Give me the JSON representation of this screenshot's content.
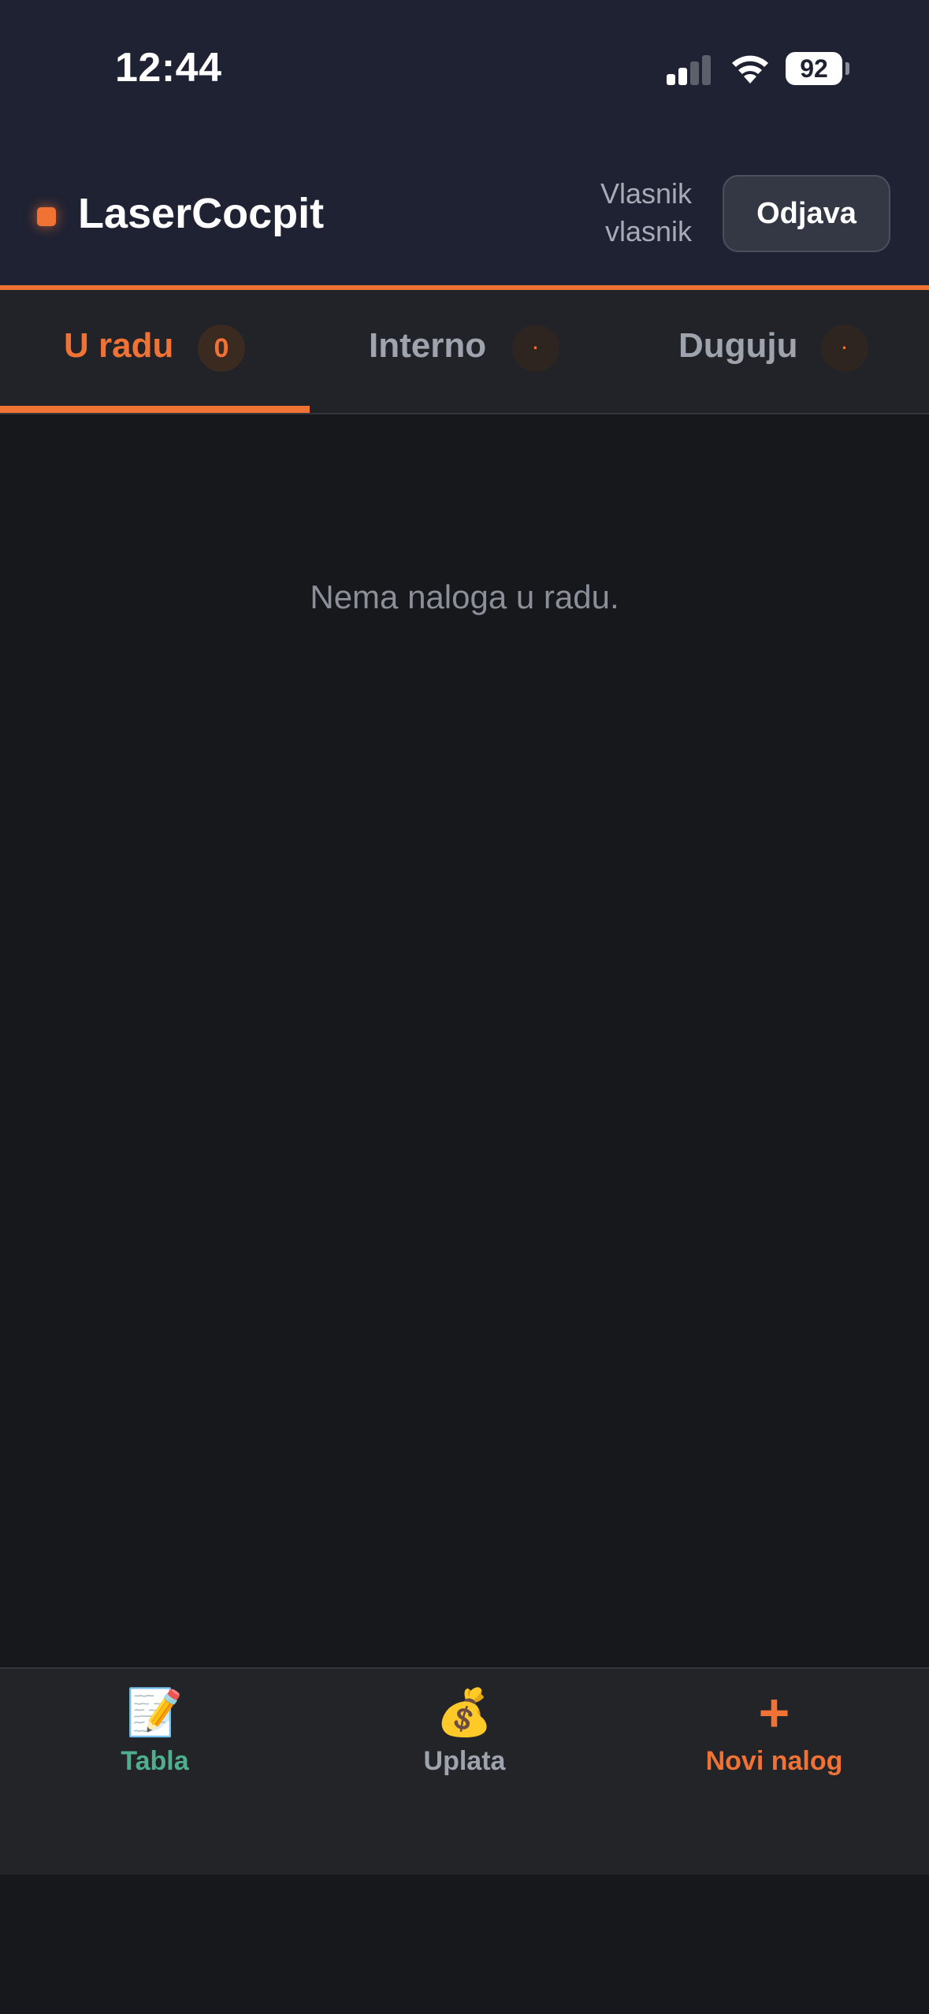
{
  "status_bar": {
    "time": "12:44",
    "battery": "92",
    "icons": [
      "cellular-signal-icon",
      "wifi-icon",
      "battery-icon"
    ]
  },
  "header": {
    "brand": "LaserCocpit",
    "user_role": "Vlasnik",
    "username": "vlasnik",
    "logout_label": "Odjava"
  },
  "tabs": [
    {
      "label": "U radu",
      "badge": "0",
      "active": true
    },
    {
      "label": "Interno",
      "badge": "·",
      "active": false
    },
    {
      "label": "Duguju",
      "badge": "·",
      "active": false
    }
  ],
  "main": {
    "empty_message": "Nema naloga u radu."
  },
  "bottom_nav": [
    {
      "label": "Tabla",
      "icon": "memo-icon",
      "glyph": "📝",
      "color": "#4fae8e"
    },
    {
      "label": "Uplata",
      "icon": "money-bag-icon",
      "glyph": "💰",
      "color": "#9ea3ad"
    },
    {
      "label": "Novi nalog",
      "icon": "plus-icon",
      "glyph": "+",
      "color": "#f07235"
    }
  ],
  "colors": {
    "accent": "#f07235",
    "header_bg": "#1e2233",
    "background": "#17181c",
    "active_nav": "#4fae8e"
  }
}
